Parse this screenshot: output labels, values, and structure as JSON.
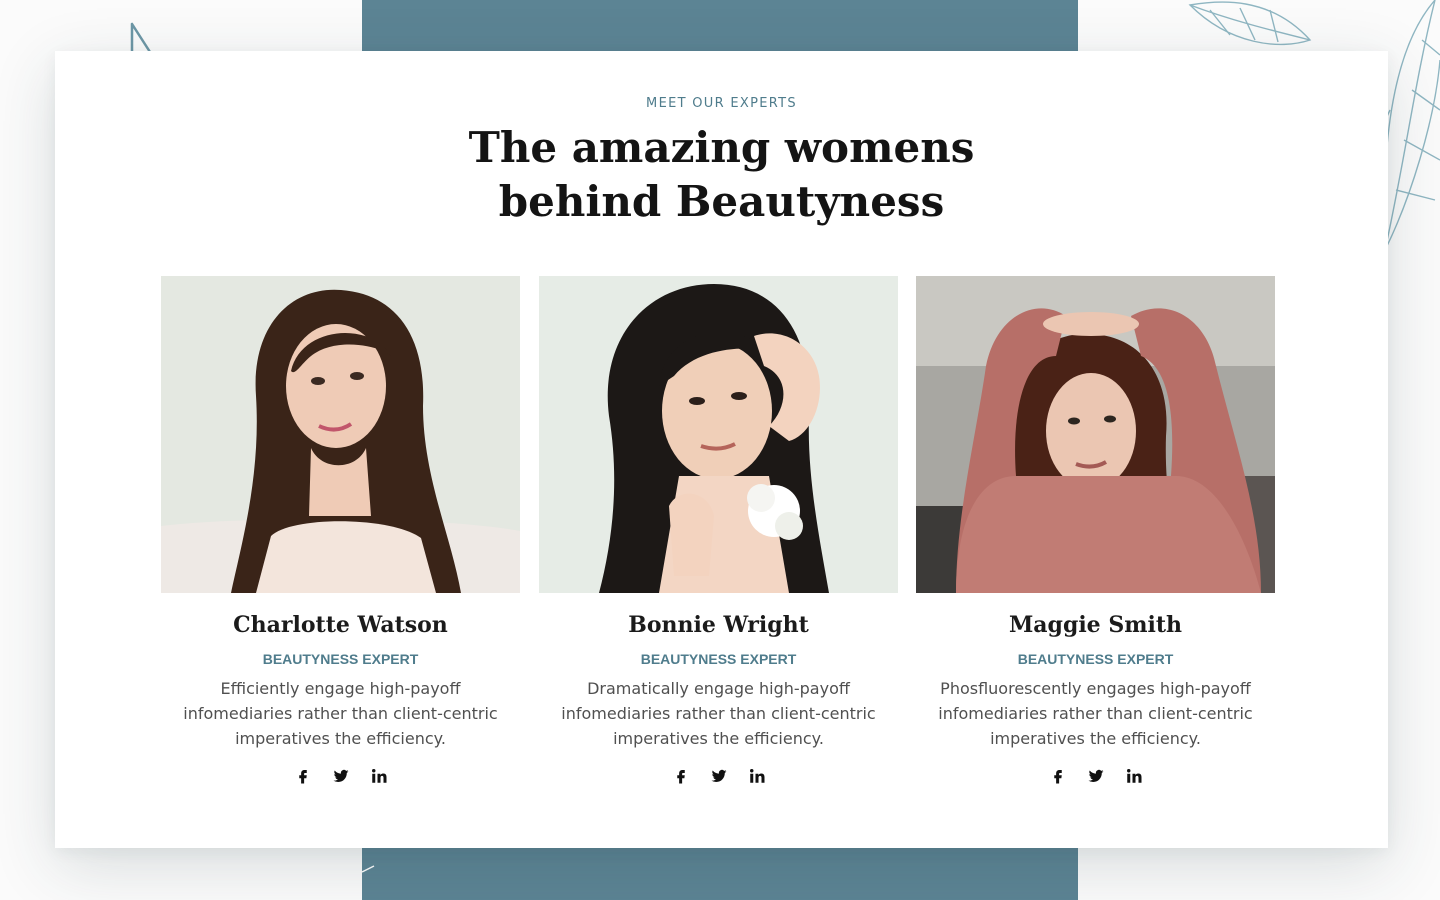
{
  "section": {
    "eyebrow": "MEET OUR EXPERTS",
    "heading_line1": "The amazing womens",
    "heading_line2": "behind Beautyness"
  },
  "experts": [
    {
      "name": "Charlotte Watson",
      "role": "BEAUTYNESS EXPERT",
      "bio": "Efficiently engage high-payoff infomediaries rather than client-centric imperatives the efficiency.",
      "socials": [
        "facebook-icon",
        "twitter-icon",
        "linkedin-icon"
      ]
    },
    {
      "name": "Bonnie Wright",
      "role": "BEAUTYNESS EXPERT",
      "bio": "Dramatically engage high-payoff infomediaries rather than client-centric imperatives the efficiency.",
      "socials": [
        "facebook-icon",
        "twitter-icon",
        "linkedin-icon"
      ]
    },
    {
      "name": "Maggie Smith",
      "role": "BEAUTYNESS EXPERT",
      "bio": "Phosfluorescently engages high-payoff infomediaries rather than client-centric imperatives the efficiency.",
      "socials": [
        "facebook-icon",
        "twitter-icon",
        "linkedin-icon"
      ]
    }
  ],
  "colors": {
    "accent": "#5c8494",
    "accent_text": "#4f7c8c",
    "heading": "#141414",
    "body": "#505050"
  }
}
